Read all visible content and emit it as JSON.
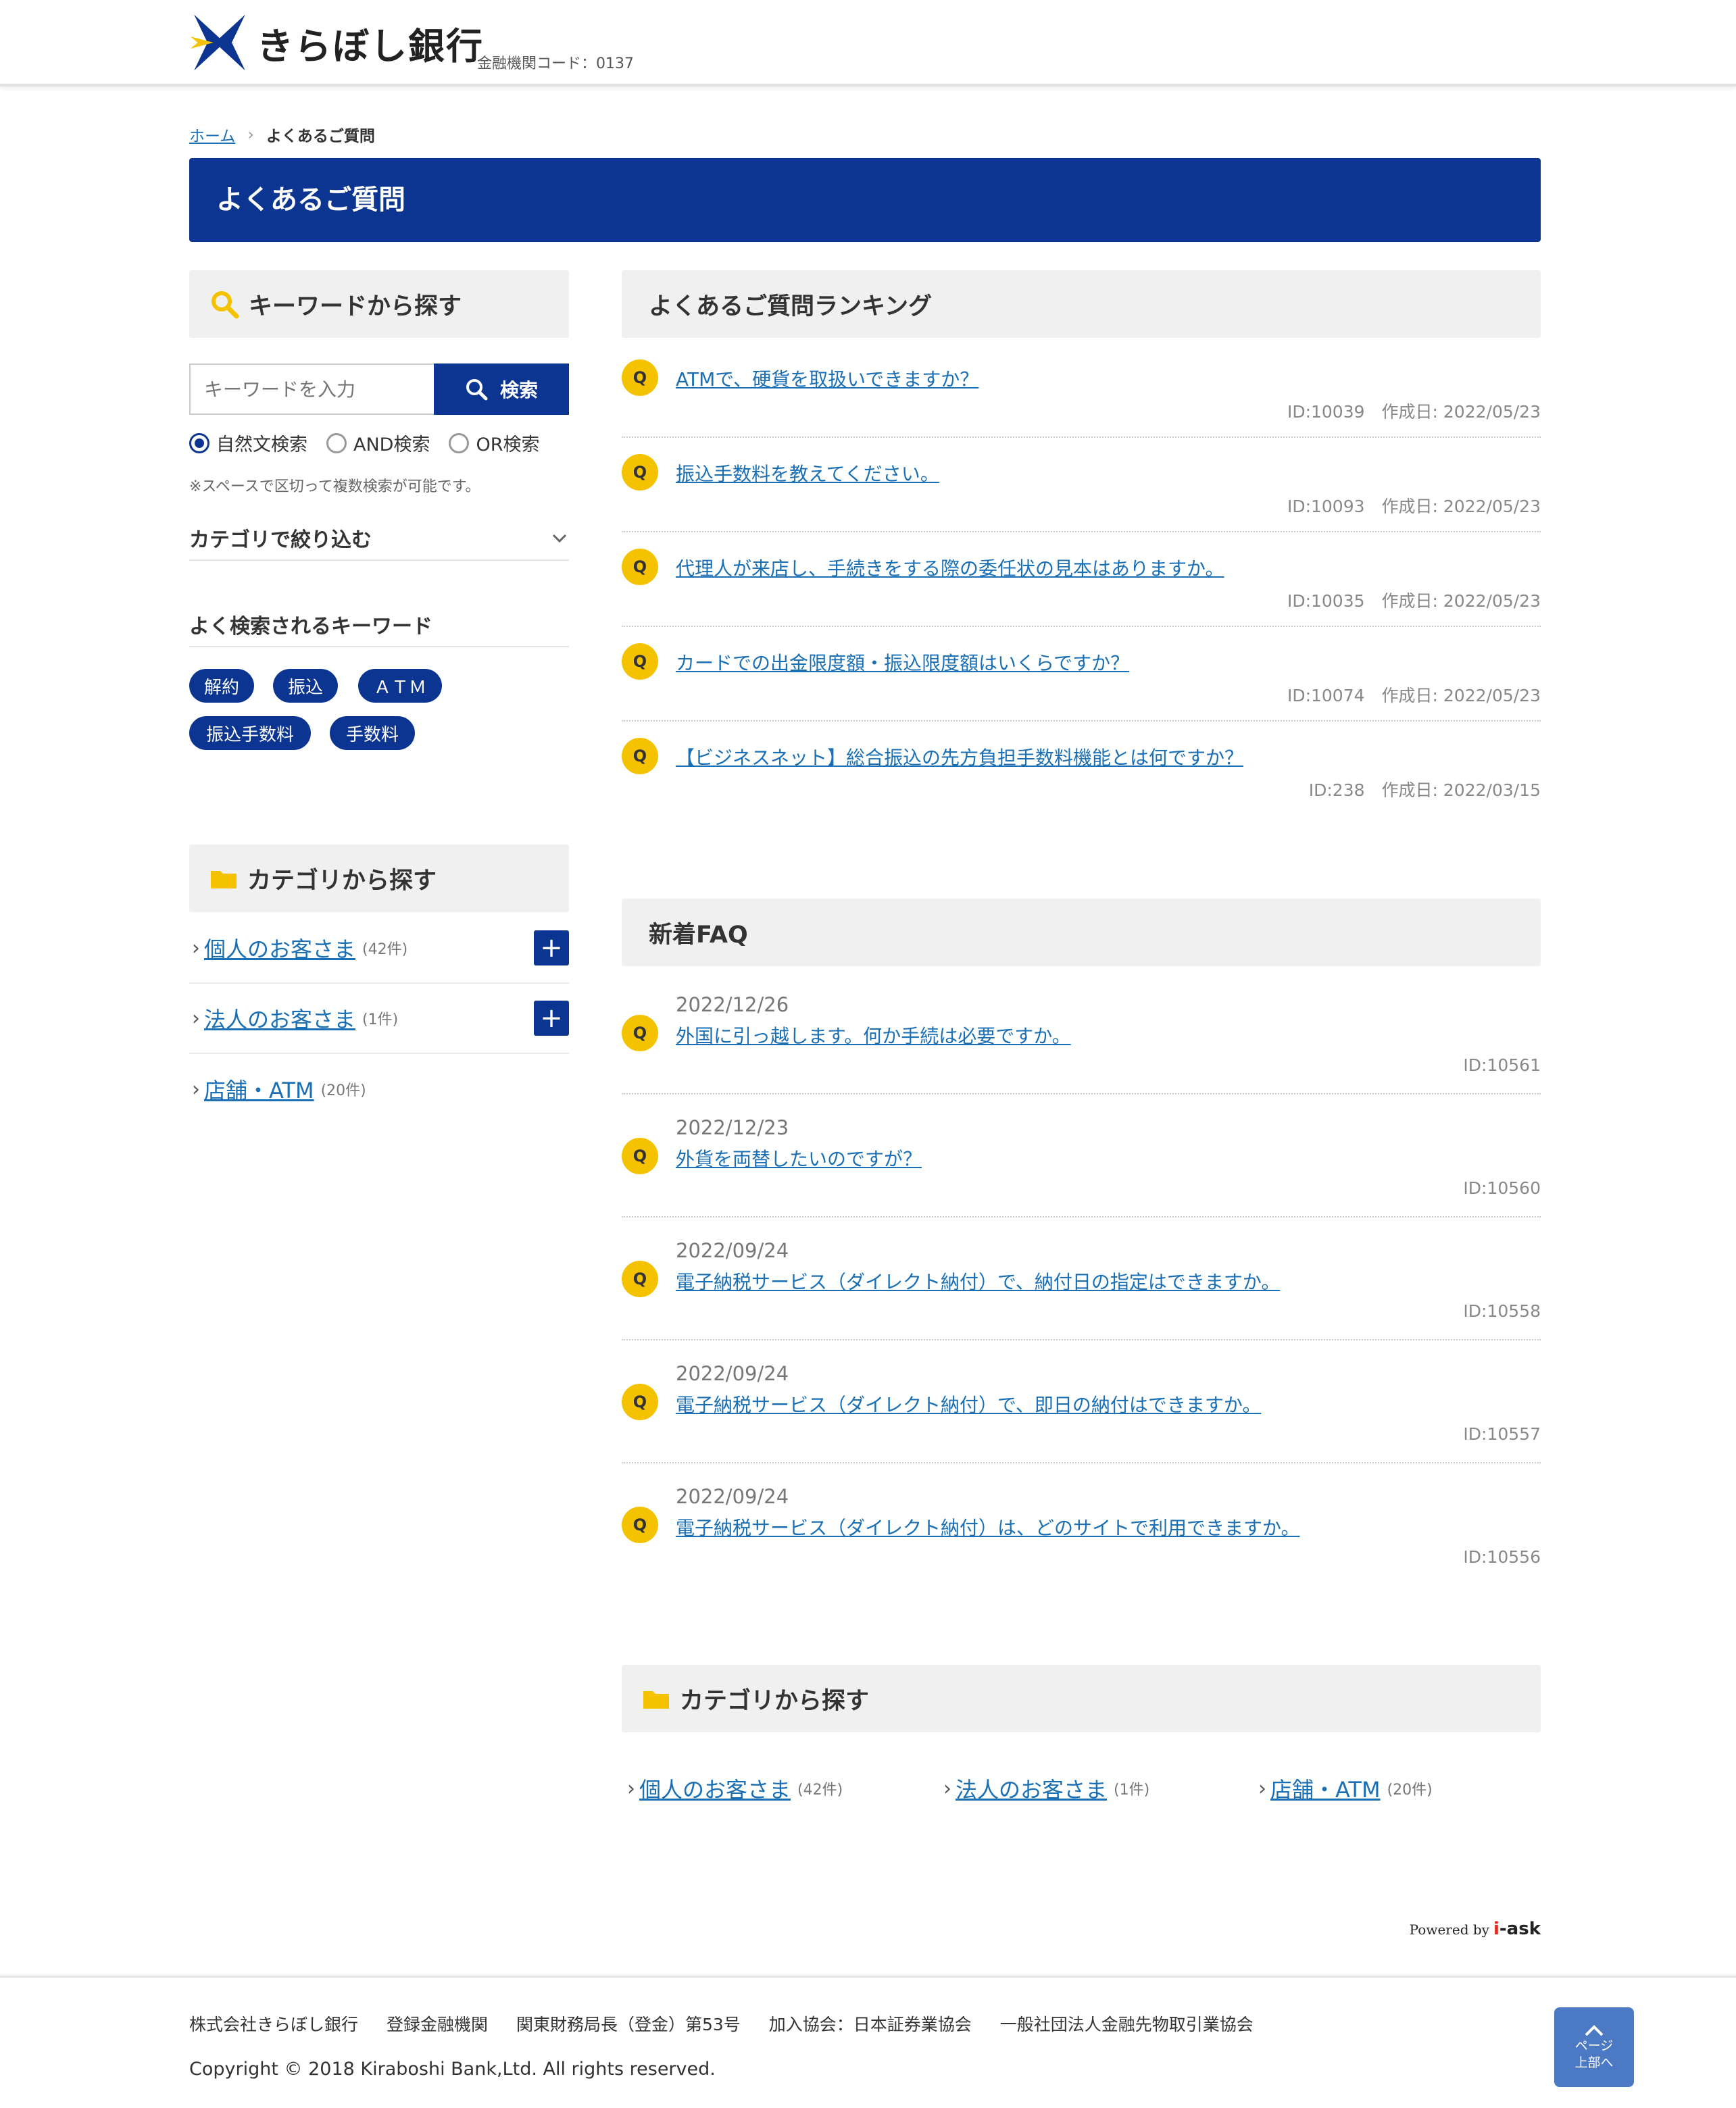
{
  "header": {
    "logo_text": "きらぼし銀行",
    "bank_code": "金融機関コード：0137"
  },
  "breadcrumb": {
    "home": "ホーム",
    "current": "よくあるご質問"
  },
  "page_title": "よくあるご質問",
  "sidebar": {
    "keyword_title": "キーワードから探す",
    "search_placeholder": "キーワードを入力",
    "search_button": "検索",
    "radios": [
      {
        "label": "自然文検索",
        "checked": true
      },
      {
        "label": "AND検索",
        "checked": false
      },
      {
        "label": "OR検索",
        "checked": false
      }
    ],
    "hint": "※スペースで区切って複数検索が可能です。",
    "category_filter": "カテゴリで絞り込む",
    "frequent_title": "よく検索されるキーワード",
    "tags": [
      "解約",
      "振込",
      "ＡＴＭ",
      "振込手数料",
      "手数料"
    ],
    "category_title": "カテゴリから探す",
    "categories": [
      {
        "label": "個人のお客さま",
        "count": "(42件)",
        "expandable": true
      },
      {
        "label": "法人のお客さま",
        "count": "(1件)",
        "expandable": true
      },
      {
        "label": "店舗・ATM",
        "count": "(20件)",
        "expandable": false
      }
    ]
  },
  "ranking": {
    "title": "よくあるご質問ランキング",
    "q_mark": "Q",
    "items": [
      {
        "question": "ATMで、硬貨を取扱いできますか？",
        "meta": "ID:10039　作成日: 2022/05/23"
      },
      {
        "question": "振込手数料を教えてください。",
        "meta": "ID:10093　作成日: 2022/05/23"
      },
      {
        "question": "代理人が来店し、手続きをする際の委任状の見本はありますか。",
        "meta": "ID:10035　作成日: 2022/05/23"
      },
      {
        "question": "カードでの出金限度額・振込限度額はいくらですか？",
        "meta": "ID:10074　作成日: 2022/05/23"
      },
      {
        "question": "【ビジネスネット】総合振込の先方負担手数料機能とは何ですか？",
        "meta": "ID:238　作成日: 2022/03/15"
      }
    ]
  },
  "new_faq": {
    "title": "新着FAQ",
    "items": [
      {
        "date": "2022/12/26",
        "question": "外国に引っ越します。何か手続は必要ですか。",
        "meta": "ID:10561"
      },
      {
        "date": "2022/12/23",
        "question": "外貨を両替したいのですが？",
        "meta": "ID:10560"
      },
      {
        "date": "2022/09/24",
        "question": "電子納税サービス（ダイレクト納付）で、納付日の指定はできますか。",
        "meta": "ID:10558"
      },
      {
        "date": "2022/09/24",
        "question": "電子納税サービス（ダイレクト納付）で、即日の納付はできますか。",
        "meta": "ID:10557"
      },
      {
        "date": "2022/09/24",
        "question": "電子納税サービス（ダイレクト納付）は、どのサイトで利用できますか。",
        "meta": "ID:10556"
      }
    ]
  },
  "bottom_categories": {
    "title": "カテゴリから探す",
    "items": [
      {
        "label": "個人のお客さま",
        "count": "(42件)"
      },
      {
        "label": "法人のお客さま",
        "count": "(1件)"
      },
      {
        "label": "店舗・ATM",
        "count": "(20件)"
      }
    ]
  },
  "powered": {
    "prefix": "Powered by",
    "brand_i": "i",
    "brand_rest": "-ask"
  },
  "footer": {
    "company": "株式会社きらぼし銀行",
    "registered": "登録金融機関",
    "bureau": "関東財務局長（登金）第53号",
    "association": "加入協会：日本証券業協会",
    "association2": "一般社団法人金融先物取引業協会",
    "copyright": "Copyright © 2018 Kiraboshi Bank,Ltd.  All rights reserved.",
    "to_top_line1": "ページ",
    "to_top_line2": "上部へ"
  },
  "colors": {
    "brand_blue": "#0c3591",
    "accent_yellow": "#f5c200",
    "link": "#1a6fb5"
  }
}
